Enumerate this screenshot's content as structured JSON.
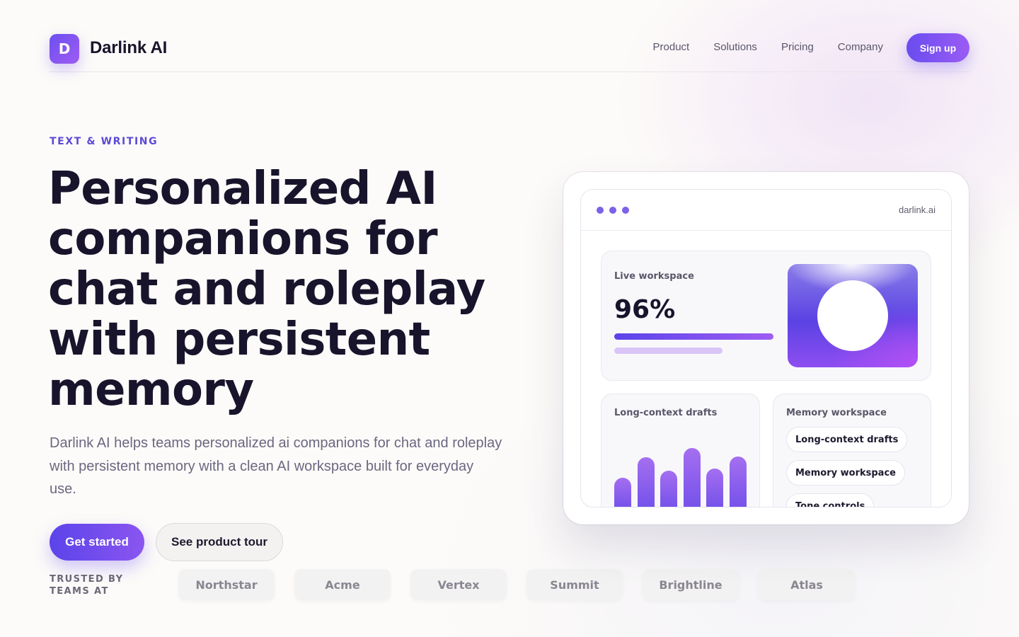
{
  "brand": {
    "logo_letter": "D",
    "name": "Darlink AI"
  },
  "nav": {
    "items": [
      {
        "label": "Product"
      },
      {
        "label": "Solutions"
      },
      {
        "label": "Pricing"
      },
      {
        "label": "Company"
      }
    ],
    "signup_label": "Sign up"
  },
  "hero": {
    "eyebrow": "TEXT & WRITING",
    "headline": "Personalized AI companions for chat and roleplay with persistent memory",
    "subcopy": "Darlink AI helps teams personalized ai companions for chat and roleplay with persistent memory with a clean AI workspace built for everyday use.",
    "primary_cta": "Get started",
    "secondary_cta": "See product tour"
  },
  "trusted": {
    "label": "TRUSTED BY TEAMS AT",
    "logos": [
      "Northstar",
      "Acme",
      "Vertex",
      "Summit",
      "Brightline",
      "Atlas"
    ]
  },
  "mockup": {
    "url": "darlink.ai",
    "live_card": {
      "title": "Live workspace",
      "stat": "96%",
      "progress_primary": 1.0,
      "progress_secondary": 0.68
    },
    "drafts_card": {
      "title": "Long-context drafts",
      "bar_levels": [
        0.5,
        0.85,
        0.62,
        1.0,
        0.66,
        0.86
      ]
    },
    "memory_card": {
      "title": "Memory workspace",
      "pills": [
        "Long-context drafts",
        "Memory workspace",
        "Tone controls"
      ]
    }
  },
  "colors": {
    "accent": "#5b44ea",
    "accent_secondary": "#9f5cf2",
    "heading": "#17142b",
    "body_text": "#6b6780"
  }
}
